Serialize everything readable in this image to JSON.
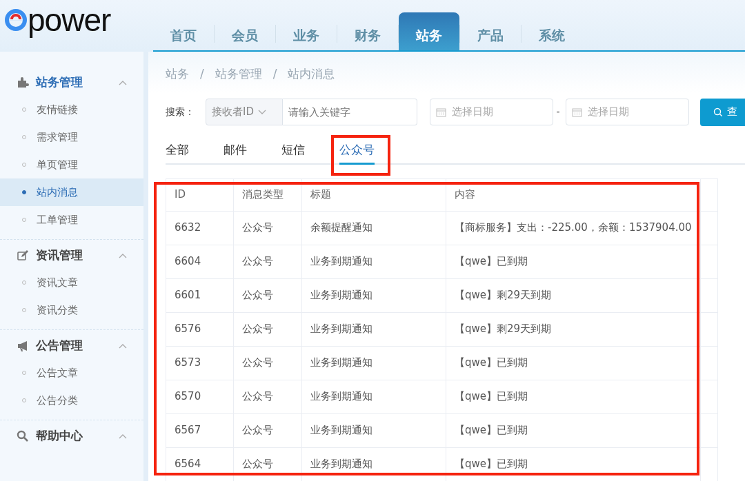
{
  "logo": {
    "text": "power"
  },
  "nav": [
    {
      "label": "首页",
      "selected": false
    },
    {
      "label": "会员",
      "selected": false
    },
    {
      "label": "业务",
      "selected": false
    },
    {
      "label": "财务",
      "selected": false
    },
    {
      "label": "站务",
      "selected": true
    },
    {
      "label": "产品",
      "selected": false
    },
    {
      "label": "系统",
      "selected": false
    }
  ],
  "sidebar": [
    {
      "title": "站务管理",
      "expanded": true,
      "selected": true,
      "items": [
        {
          "label": "友情链接",
          "selected": false
        },
        {
          "label": "需求管理",
          "selected": false
        },
        {
          "label": "单页管理",
          "selected": false
        },
        {
          "label": "站内消息",
          "selected": true
        },
        {
          "label": "工单管理",
          "selected": false
        }
      ]
    },
    {
      "title": "资讯管理",
      "expanded": true,
      "selected": false,
      "items": [
        {
          "label": "资讯文章",
          "selected": false
        },
        {
          "label": "资讯分类",
          "selected": false
        }
      ]
    },
    {
      "title": "公告管理",
      "expanded": true,
      "selected": false,
      "items": [
        {
          "label": "公告文章",
          "selected": false
        },
        {
          "label": "公告分类",
          "selected": false
        }
      ]
    },
    {
      "title": "帮助中心",
      "expanded": true,
      "selected": false
    }
  ],
  "breadcrumb": [
    "站务",
    "/",
    "站务管理",
    "/",
    "站内消息"
  ],
  "search": {
    "label": "搜索：",
    "field_select": "接收者ID",
    "keyword_placeholder": "请输入关键字",
    "start_date_placeholder": "选择日期",
    "date_separator": "-",
    "end_date_placeholder": "选择日期",
    "button": "查"
  },
  "tabs": [
    {
      "label": "全部",
      "selected": false
    },
    {
      "label": "邮件",
      "selected": false
    },
    {
      "label": "短信",
      "selected": false
    },
    {
      "label": "公众号",
      "selected": true
    }
  ],
  "table": {
    "columns": [
      "ID",
      "消息类型",
      "标题",
      "内容"
    ],
    "rows": [
      [
        "6632",
        "公众号",
        "余额提醒通知",
        "【商标服务】支出：-225.00，余额：1537904.00"
      ],
      [
        "6604",
        "公众号",
        "业务到期通知",
        "【qwe】已到期"
      ],
      [
        "6601",
        "公众号",
        "业务到期通知",
        "【qwe】剩29天到期"
      ],
      [
        "6576",
        "公众号",
        "业务到期通知",
        "【qwe】剩29天到期"
      ],
      [
        "6573",
        "公众号",
        "业务到期通知",
        "【qwe】已到期"
      ],
      [
        "6570",
        "公众号",
        "业务到期通知",
        "【qwe】已到期"
      ],
      [
        "6567",
        "公众号",
        "业务到期通知",
        "【qwe】已到期"
      ],
      [
        "6564",
        "公众号",
        "业务到期通知",
        "【qwe】已到期"
      ]
    ]
  }
}
